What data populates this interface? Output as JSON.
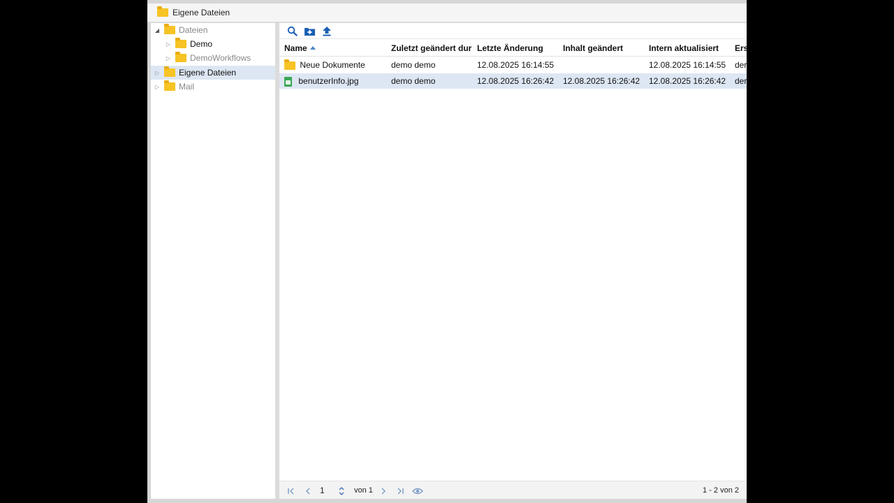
{
  "window": {
    "title": "Eigene Dateien"
  },
  "tree": {
    "items": [
      {
        "label": "Dateien",
        "expanded": true,
        "level": 0
      },
      {
        "label": "Demo",
        "level": 1
      },
      {
        "label": "DemoWorkflows",
        "level": 1
      },
      {
        "label": "Eigene Dateien",
        "level": 0,
        "selected": true
      },
      {
        "label": "Mail",
        "level": 0
      }
    ]
  },
  "toolbar": {
    "buttons": [
      {
        "icon": "search-icon"
      },
      {
        "icon": "new-folder-icon"
      },
      {
        "icon": "upload-icon"
      }
    ]
  },
  "grid": {
    "columns": [
      "Name",
      "Zuletzt geändert dur",
      "Letzte Änderung",
      "Inhalt geändert",
      "Intern aktualisiert",
      "Ers"
    ],
    "sort": {
      "column": "Name",
      "direction": "asc"
    },
    "rows": [
      {
        "type": "folder",
        "name": "Neue Dokumente",
        "changed_by": "demo demo",
        "last_change": "12.08.2025 16:14:55",
        "content_changed": "",
        "internal_updated": "12.08.2025 16:14:55",
        "created_by": "der"
      },
      {
        "type": "image",
        "name": "benutzerInfo.jpg",
        "changed_by": "demo demo",
        "last_change": "12.08.2025 16:26:42",
        "content_changed": "12.08.2025 16:26:42",
        "internal_updated": "12.08.2025 16:26:42",
        "created_by": "der",
        "selected": true
      }
    ]
  },
  "pager": {
    "page": "1",
    "of_label": "von 1",
    "summary": "1 - 2 von 2"
  },
  "colors": {
    "accent": "#1a73c9",
    "folder": "#f7c325",
    "selection": "#dde6f3"
  }
}
